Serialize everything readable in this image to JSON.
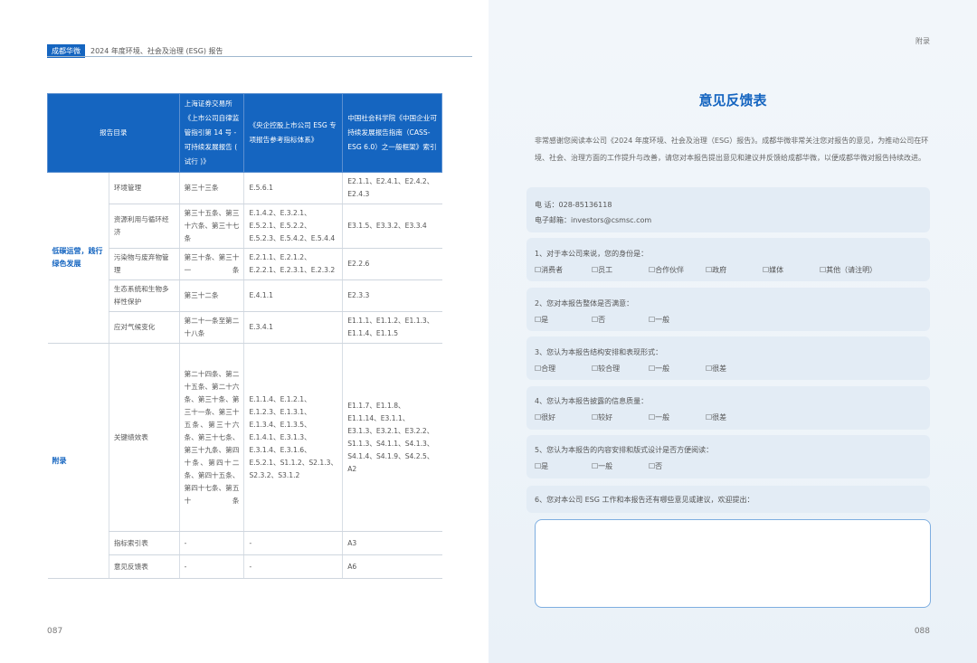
{
  "header": {
    "brand": "成都华微",
    "title": "2024 年度环境、社会及治理 (ESG) 报告",
    "right_label": "附录"
  },
  "pages": {
    "left": "087",
    "right": "088"
  },
  "table": {
    "headers": [
      "报告目录",
      "上海证券交易所《上市公司自律监管指引第 14 号 - 可持续发展报告 ( 试行 )》",
      "《央企控股上市公司 ESG 专项报告参考指标体系》",
      "中国社会科学院《中国企业可持续发展报告指南（CASS-ESG 6.0）之一般框架》索引"
    ],
    "groups": [
      {
        "category": "低碳运营，践行绿色发展",
        "rows": [
          {
            "topic": "环境管理",
            "sse": "第三十三条",
            "sasac": "E.5.6.1",
            "cass": "E2.1.1、E2.4.1、E2.4.2、E2.4.3"
          },
          {
            "topic": "资源利用与循环经济",
            "sse": "第三十五条、第三十六条、第三十七条",
            "sasac": "E.1.4.2、E.3.2.1、E.5.2.1、E.5.2.2、E.5.2.3、E.5.4.2、E.5.4.4",
            "cass": "E3.1.5、E3.3.2、E3.3.4"
          },
          {
            "topic": "污染物与废弃物管理",
            "sse": "第三十条、第三十一条",
            "sasac": "E.2.1.1、E.2.1.2、E.2.2.1、E.2.3.1、E.2.3.2",
            "cass": "E2.2.6"
          },
          {
            "topic": "生态系统和生物多样性保护",
            "sse": "第三十二条",
            "sasac": "E.4.1.1",
            "cass": "E2.3.3"
          },
          {
            "topic": "应对气候变化",
            "sse": "第二十一条至第二十八条",
            "sasac": "E.3.4.1",
            "cass": "E1.1.1、E1.1.2、E1.1.3、E1.1.4、E1.1.5"
          }
        ]
      },
      {
        "category": "附录",
        "rows": [
          {
            "topic": "关键绩效表",
            "sse": "第二十四条、第二十五条、第二十六条、第三十条、第三十一条、第三十五条、第三十六条、第三十七条、第三十九条、第四十条、第四十二条、第四十五条、第四十七条、第五十条",
            "sasac": "E.1.1.4、E.1.2.1、E.1.2.3、E.1.3.1、E.1.3.4、E.1.3.5、E.1.4.1、E.3.1.3、E.3.1.4、E.3.1.6、E.5.2.1、S1.1.2、S2.1.3、S2.3.2、S3.1.2",
            "cass": "E1.1.7、E1.1.8、E1.1.14、E3.1.1、E3.1.3、E3.2.1、E3.2.2、S1.1.3、S4.1.1、S4.1.3、S4.1.4、S4.1.9、S4.2.5、A2"
          },
          {
            "topic": "指标索引表",
            "sse": "-",
            "sasac": "-",
            "cass": "A3"
          },
          {
            "topic": "意见反馈表",
            "sse": "-",
            "sasac": "-",
            "cass": "A6"
          }
        ]
      }
    ]
  },
  "feedback": {
    "title": "意见反馈表",
    "intro": "非常感谢您阅读本公司《2024 年度环境、社会及治理（ESG）报告》。成都华微非常关注您对报告的意见，为推动公司在环境、社会、治理方面的工作提升与改善，请您对本报告提出意见和建议并反馈给成都华微，以便成都华微对报告持续改进。",
    "phone": "电      话：028-85136118",
    "email": "电子邮箱：investors@csmsc.com",
    "questions": [
      {
        "q": "1、对于本公司来说，您的身份是：",
        "options": [
          "☐消费者",
          "☐员工",
          "☐合作伙伴",
          "☐政府",
          "☐媒体",
          "☐其他（请注明）"
        ]
      },
      {
        "q": "2、您对本报告整体是否满意：",
        "options": [
          "☐是",
          "☐否",
          "☐一般"
        ]
      },
      {
        "q": "3、您认为本报告结构安排和表现形式：",
        "options": [
          "☐合理",
          "☐较合理",
          "☐一般",
          "☐很差"
        ]
      },
      {
        "q": "4、您认为本报告披露的信息质量：",
        "options": [
          "☐很好",
          "☐较好",
          "☐一般",
          "☐很差"
        ]
      },
      {
        "q": "5、您认为本报告的内容安排和版式设计是否方便阅读：",
        "options": [
          "☐是",
          "☐一般",
          "☐否"
        ]
      },
      {
        "q": "6、您对本公司 ESG 工作和本报告还有哪些意见或建议，欢迎提出：",
        "options": []
      }
    ]
  },
  "colors": {
    "accent": "#1565c0",
    "right_bg": "#eef4f9",
    "box_bg": "#e3ecf5"
  }
}
